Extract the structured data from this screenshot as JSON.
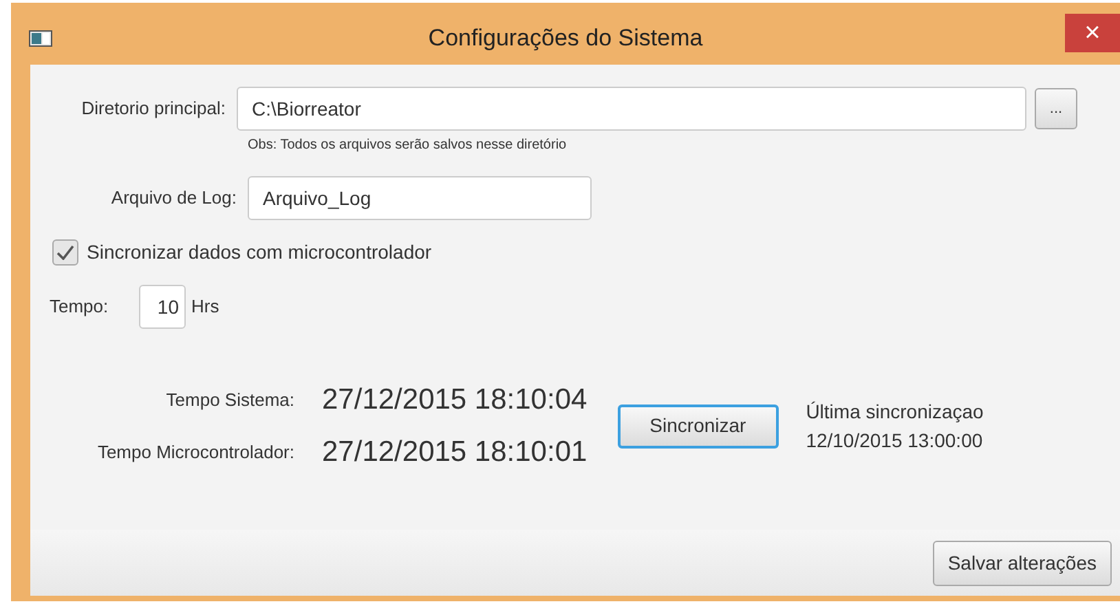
{
  "window": {
    "title": "Configurações do Sistema",
    "close": "×"
  },
  "directory": {
    "label": "Diretorio principal:",
    "value": "C:\\Biorreator",
    "browse": "...",
    "note": "Obs: Todos os arquivos serão salvos nesse diretório"
  },
  "log_file": {
    "label": "Arquivo de Log:",
    "value": "Arquivo_Log"
  },
  "sync_checkbox": {
    "label": "Sincronizar dados com microcontrolador",
    "checked": true
  },
  "interval": {
    "label": "Tempo:",
    "value": "10",
    "unit": "Hrs"
  },
  "times": [
    {
      "label": "Tempo Sistema:",
      "value": "27/12/2015 18:10:04"
    },
    {
      "label": "Tempo Microcontrolador:",
      "value": "27/12/2015 18:10:01"
    }
  ],
  "sync_button": "Sincronizar",
  "last_sync": {
    "label": "Última sincronizaçao",
    "value": "12/10/2015 13:00:00"
  },
  "save_button": "Salvar alterações"
}
